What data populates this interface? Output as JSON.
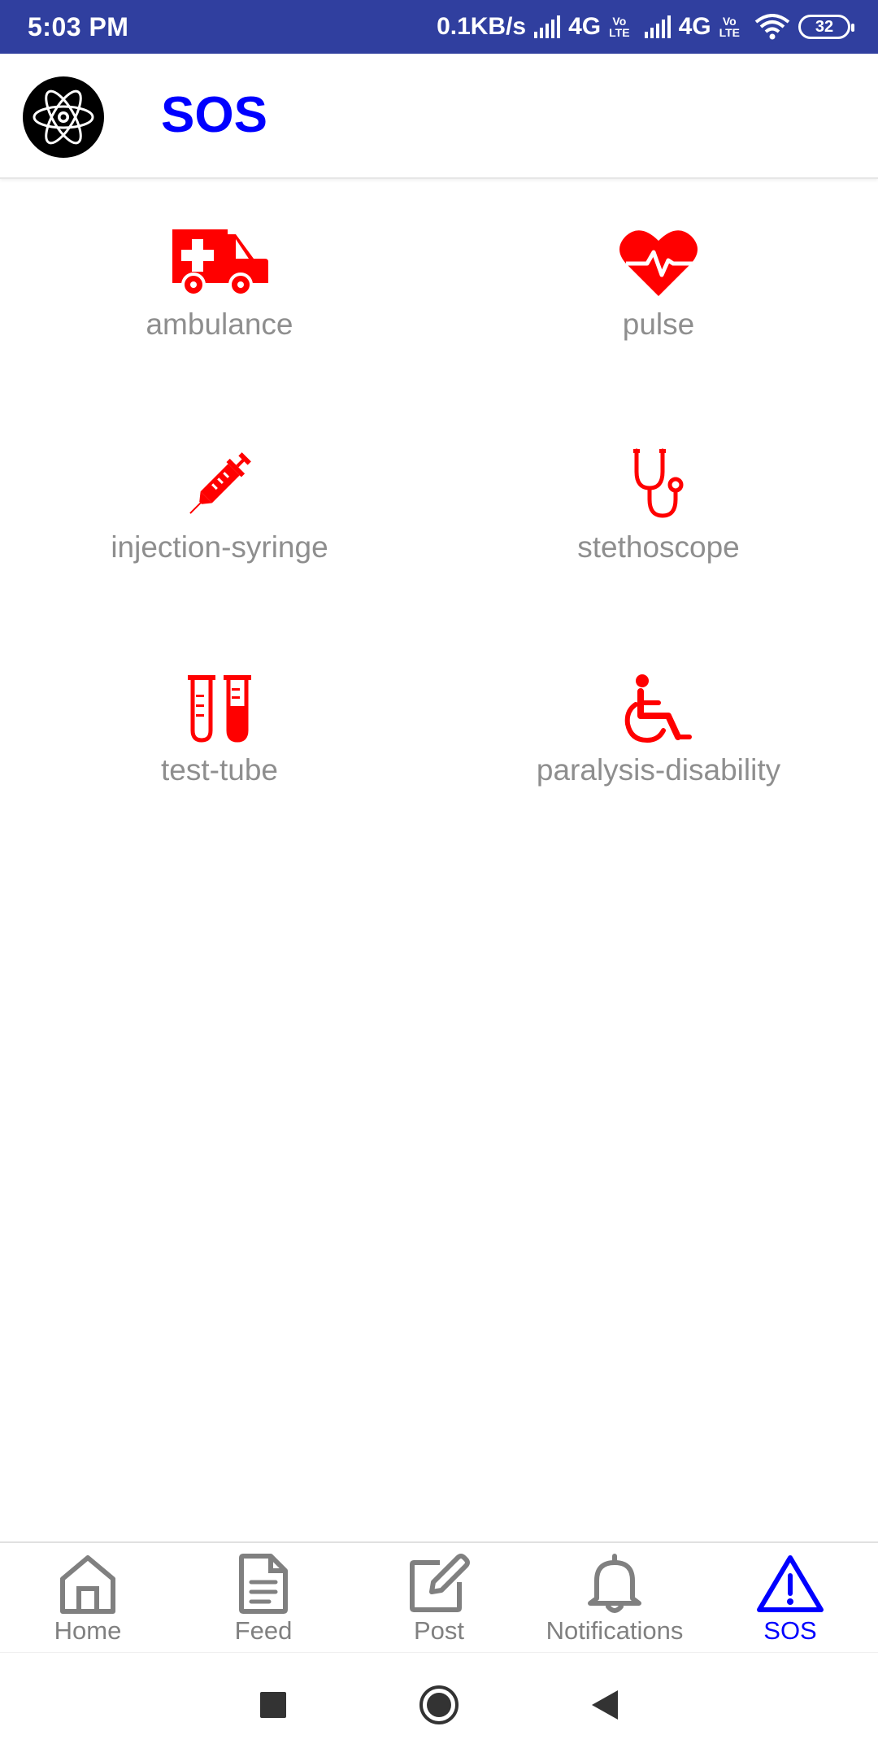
{
  "status_bar": {
    "time": "5:03 PM",
    "speed": "0.1KB/s",
    "network1": "4G",
    "volte1_top": "Vo",
    "volte1_bottom": "LTE",
    "network2": "4G",
    "volte2_top": "Vo",
    "volte2_bottom": "LTE",
    "battery": "32"
  },
  "header": {
    "title": "SOS",
    "logo_icon": "atom-icon"
  },
  "grid": {
    "items": [
      {
        "label": "ambulance",
        "icon": "ambulance-icon"
      },
      {
        "label": "pulse",
        "icon": "heart-pulse-icon"
      },
      {
        "label": "injection-syringe",
        "icon": "syringe-icon"
      },
      {
        "label": "stethoscope",
        "icon": "stethoscope-icon"
      },
      {
        "label": "test-tube",
        "icon": "test-tube-icon"
      },
      {
        "label": "paralysis-disability",
        "icon": "wheelchair-icon"
      }
    ]
  },
  "bottom_nav": {
    "items": [
      {
        "label": "Home",
        "icon": "home-icon",
        "active": false
      },
      {
        "label": "Feed",
        "icon": "document-icon",
        "active": false
      },
      {
        "label": "Post",
        "icon": "edit-icon",
        "active": false
      },
      {
        "label": "Notifications",
        "icon": "bell-icon",
        "active": false
      },
      {
        "label": "SOS",
        "icon": "warning-icon",
        "active": true
      }
    ]
  },
  "colors": {
    "status_bar": "#303f9f",
    "title": "#0000ff",
    "icon_red": "#ff0000",
    "label_gray": "#8e8e8e",
    "nav_gray": "#808080",
    "nav_active": "#0000ff"
  }
}
